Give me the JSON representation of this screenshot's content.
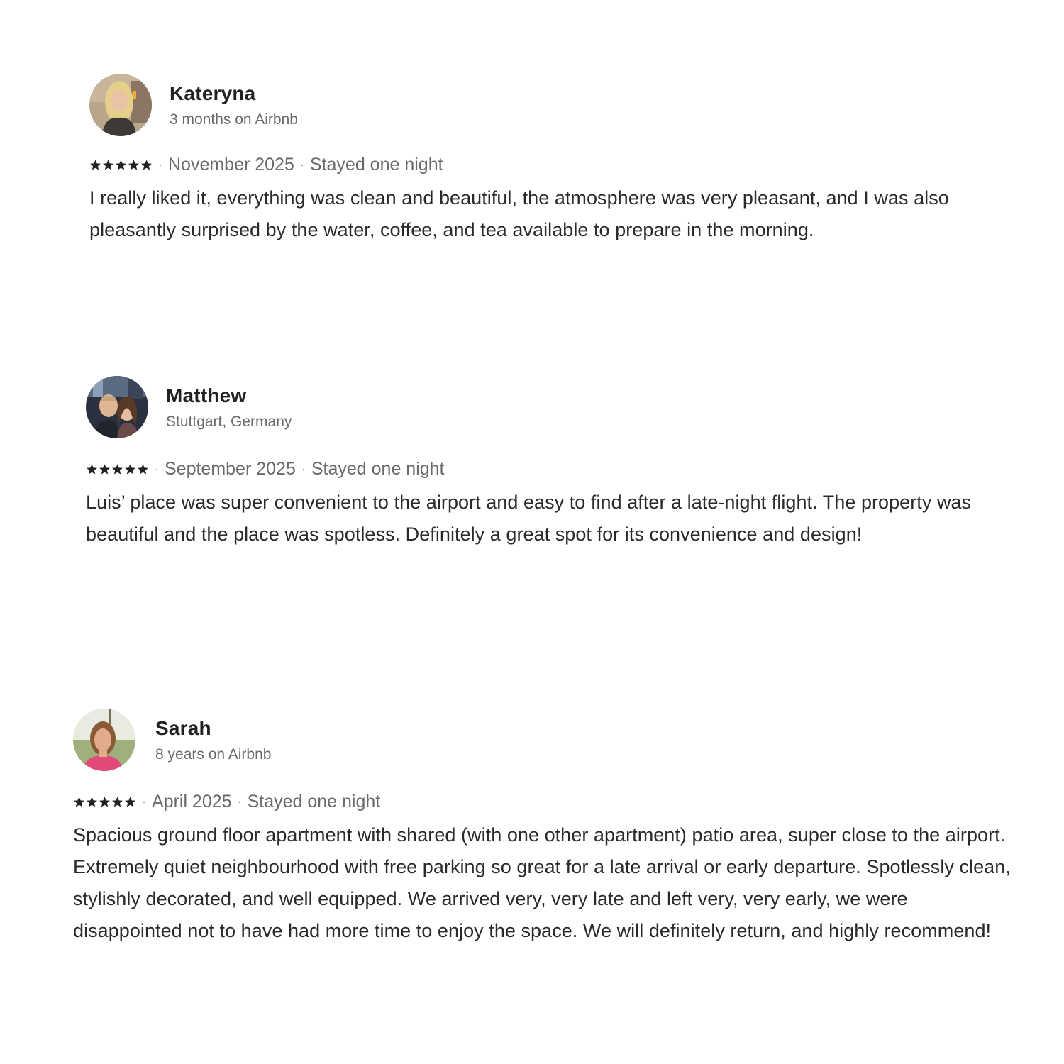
{
  "reviews": [
    {
      "name": "Kateryna",
      "subtitle": "3 months on Airbnb",
      "rating": 5,
      "date": "November 2025",
      "stay": "Stayed one night",
      "text": "I really liked it, everything was clean and beautiful, the atmosphere was very pleasant, and I was also pleasantly surprised by the water, coffee, and tea available to prepare in the morning."
    },
    {
      "name": "Matthew",
      "subtitle": "Stuttgart, Germany",
      "rating": 5,
      "date": "September 2025",
      "stay": "Stayed one night",
      "text": "Luis’ place was super convenient to the airport and easy to find after a late-night flight. The property was beautiful and the place was spotless. Definitely a great spot for its convenience and design!"
    },
    {
      "name": "Sarah",
      "subtitle": "8 years on Airbnb",
      "rating": 5,
      "date": "April 2025",
      "stay": "Stayed one night",
      "text": "Spacious ground floor apartment with shared (with one other apartment) patio area, super close to the airport. Extremely quiet neighbourhood with free parking so great for a late arrival or early departure. Spotlessly clean, stylishly decorated, and well equipped. We arrived very, very late and left very, very early, we were disappointed not to have had more time to enjoy the space. We will definitely return, and highly recommend!"
    }
  ],
  "meta_separator": "·",
  "icons": {
    "star": "star-icon",
    "avatar": "avatar-photo"
  },
  "colors": {
    "text_primary": "#222222",
    "text_secondary": "#6a6a6a",
    "background": "#ffffff"
  }
}
